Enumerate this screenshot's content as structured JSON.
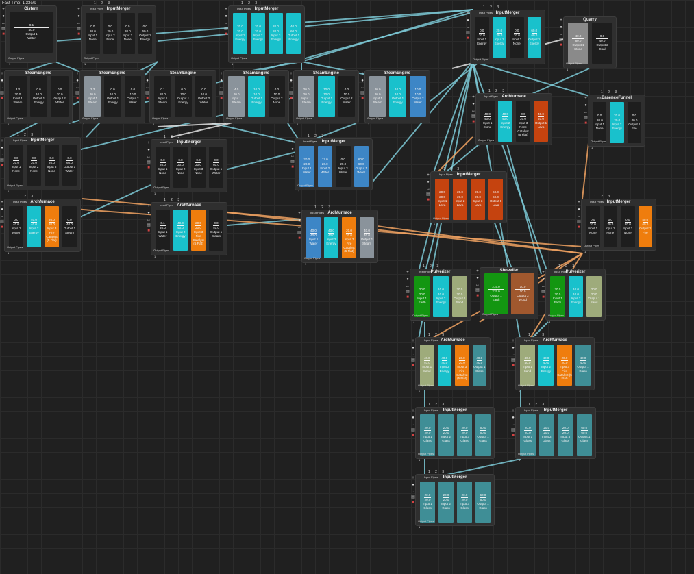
{
  "fps_label": "Fast Time: 1.33e/s",
  "labels": {
    "input_pipes": "Input Pipes",
    "output_pipes": "Output Pipes"
  },
  "colors": {
    "Water": "#19c1cc",
    "Energy": "#19c1cc",
    "Steam": "#8a939b",
    "Lava": "#c5430f",
    "Fire": "#ef7d0d",
    "Earth": "#139611",
    "Wood": "#a0582e",
    "Sand": "#9eab7b",
    "Glass": "#3f8e96",
    "None": "#1e1e1e",
    "Coal": "#1e1e1e",
    "WaterBlue": "#3d86c6",
    "Stone": "#8a8a8a"
  },
  "nodes": [
    {
      "id": "n1",
      "title": "Cistern",
      "ports": "",
      "cells": [
        {
          "v": "0.1",
          "v2": "40.0",
          "lb": "Output 1",
          "nm": "Water",
          "c": "#1e1e1e"
        }
      ]
    },
    {
      "id": "n2",
      "title": "InputMerger",
      "ports": "1 2 3",
      "cells": [
        {
          "v": "0.0",
          "v2": "20.0",
          "lb": "Input 1",
          "nm": "None",
          "c": "#1e1e1e"
        },
        {
          "v": "0.0",
          "v2": "20.0",
          "lb": "Input 2",
          "nm": "None",
          "c": "#1e1e1e"
        },
        {
          "v": "0.0",
          "v2": "20.0",
          "lb": "Input 3",
          "nm": "None",
          "c": "#1e1e1e"
        },
        {
          "v": "0.0",
          "v2": "60.0",
          "lb": "Output 1",
          "nm": "Energy",
          "c": "#1e1e1e"
        }
      ]
    },
    {
      "id": "n3",
      "title": "InputMerger",
      "ports": "1 2 3",
      "cells": [
        {
          "v": "20.0",
          "v2": "20.0",
          "lb": "Input 1",
          "nm": "Energy",
          "c": "#19c1cc"
        },
        {
          "v": "20.0",
          "v2": "20.0",
          "lb": "Input 2",
          "nm": "Energy",
          "c": "#19c1cc"
        },
        {
          "v": "20.0",
          "v2": "20.0",
          "lb": "Input 3",
          "nm": "Energy",
          "c": "#19c1cc"
        },
        {
          "v": "40.0",
          "v2": "60.0",
          "lb": "Output 1",
          "nm": "Energy",
          "c": "#19c1cc"
        }
      ]
    },
    {
      "id": "n4",
      "title": "InputMerger",
      "ports": "1 2 3",
      "cells": [
        {
          "v": "0.0",
          "v2": "20.0",
          "lb": "Input 1",
          "nm": "Energy",
          "c": "#1e1e1e"
        },
        {
          "v": "20.0",
          "v2": "20.0",
          "lb": "Input 2",
          "nm": "Energy",
          "c": "#19c1cc"
        },
        {
          "v": "0.0",
          "v2": "20.0",
          "lb": "Input 3",
          "nm": "None",
          "c": "#1e1e1e"
        },
        {
          "v": "60.0",
          "v2": "60.0",
          "lb": "Output 1",
          "nm": "Energy",
          "c": "#19c1cc"
        }
      ]
    },
    {
      "id": "n5",
      "title": "Quarry",
      "ports": "",
      "cells": [
        {
          "v": "40.0",
          "v2": "80.0",
          "lb": "Output 1",
          "nm": "Stone",
          "c": "#8a8a8a"
        },
        {
          "v": "0.0",
          "v2": "40.0",
          "lb": "Output 2",
          "nm": "Coal",
          "c": "#1e1e1e"
        }
      ]
    },
    {
      "id": "n6",
      "title": "SteamEngine",
      "ports": "",
      "cells": [
        {
          "v": "3.3",
          "v2": "20.0",
          "lb": "Input 1",
          "nm": "Steam",
          "c": "#1e1e1e"
        },
        {
          "v": "0.0",
          "v2": "10.0",
          "lb": "Output 1",
          "nm": "Energy",
          "c": "#1e1e1e"
        },
        {
          "v": "0.0",
          "v2": "10.0",
          "lb": "Output 2",
          "nm": "Water",
          "c": "#1e1e1e"
        }
      ]
    },
    {
      "id": "n7",
      "title": "SteamEngine",
      "ports": "",
      "cells": [
        {
          "v": "3.3",
          "v2": "20.0",
          "lb": "Input 1",
          "nm": "Steam",
          "c": "#8a939b"
        },
        {
          "v": "0.0",
          "v2": "10.0",
          "lb": "Output 1",
          "nm": "Energy",
          "c": "#1e1e1e"
        },
        {
          "v": "0.0",
          "v2": "10.0",
          "lb": "Output 2",
          "nm": "Water",
          "c": "#1e1e1e"
        }
      ]
    },
    {
      "id": "n8",
      "title": "SteamEngine",
      "ports": "",
      "cells": [
        {
          "v": "0.1",
          "v2": "20.0",
          "lb": "Input 1",
          "nm": "Steam",
          "c": "#1e1e1e"
        },
        {
          "v": "0.0",
          "v2": "10.0",
          "lb": "Output 1",
          "nm": "Energy",
          "c": "#1e1e1e"
        },
        {
          "v": "0.0",
          "v2": "10.0",
          "lb": "Output 2",
          "nm": "Water",
          "c": "#1e1e1e"
        }
      ]
    },
    {
      "id": "n9",
      "title": "SteamEngine",
      "ports": "",
      "cells": [
        {
          "v": "4.0",
          "v2": "20.0",
          "lb": "Input 1",
          "nm": "Steam",
          "c": "#8a939b"
        },
        {
          "v": "10.0",
          "v2": "10.0",
          "lb": "Output 1",
          "nm": "Energy",
          "c": "#19c1cc"
        },
        {
          "v": "0.0",
          "v2": "10.0",
          "lb": "Output 2",
          "nm": "None",
          "c": "#1e1e1e"
        }
      ]
    },
    {
      "id": "n10",
      "title": "SteamEngine",
      "ports": "",
      "cells": [
        {
          "v": "20.0",
          "v2": "20.0",
          "lb": "Input 1",
          "nm": "Steam",
          "c": "#8a939b"
        },
        {
          "v": "10.0",
          "v2": "10.0",
          "lb": "Output 1",
          "nm": "Energy",
          "c": "#19c1cc"
        },
        {
          "v": "0.0",
          "v2": "10.0",
          "lb": "Output 2",
          "nm": "Water",
          "c": "#1e1e1e"
        }
      ]
    },
    {
      "id": "n11",
      "title": "SteamEngine",
      "ports": "",
      "cells": [
        {
          "v": "20.0",
          "v2": "20.0",
          "lb": "Input 1",
          "nm": "Steam",
          "c": "#8a939b"
        },
        {
          "v": "10.0",
          "v2": "10.0",
          "lb": "Output 1",
          "nm": "Energy",
          "c": "#19c1cc"
        },
        {
          "v": "10.0",
          "v2": "10.0",
          "lb": "Output 2",
          "nm": "Water",
          "c": "#3d86c6"
        }
      ]
    },
    {
      "id": "n12",
      "title": "InputMerger",
      "ports": "1 2 3",
      "cells": [
        {
          "v": "0.0",
          "v2": "20.0",
          "lb": "Input 1",
          "nm": "None",
          "c": "#1e1e1e"
        },
        {
          "v": "0.0",
          "v2": "20.0",
          "lb": "Input 2",
          "nm": "None",
          "c": "#1e1e1e"
        },
        {
          "v": "0.0",
          "v2": "20.0",
          "lb": "Input 3",
          "nm": "None",
          "c": "#1e1e1e"
        },
        {
          "v": "0.0",
          "v2": "60.0",
          "lb": "Output 1",
          "nm": "Water",
          "c": "#1e1e1e"
        }
      ]
    },
    {
      "id": "n13",
      "title": "InputMerger",
      "ports": "1 2 3",
      "cells": [
        {
          "v": "0.0",
          "v2": "20.0",
          "lb": "Input 1",
          "nm": "None",
          "c": "#1e1e1e"
        },
        {
          "v": "0.0",
          "v2": "20.0",
          "lb": "Input 2",
          "nm": "None",
          "c": "#1e1e1e"
        },
        {
          "v": "0.0",
          "v2": "20.0",
          "lb": "Input 3",
          "nm": "None",
          "c": "#1e1e1e"
        },
        {
          "v": "0.0",
          "v2": "60.0",
          "lb": "Output 1",
          "nm": "Water",
          "c": "#1e1e1e"
        }
      ]
    },
    {
      "id": "n14",
      "title": "InputMerger",
      "ports": "1 2 3",
      "cells": [
        {
          "v": "20.0",
          "v2": "20.0",
          "lb": "Input 1",
          "nm": "Water",
          "c": "#3d86c6"
        },
        {
          "v": "17.0",
          "v2": "20.0",
          "lb": "Input 2",
          "nm": "Water",
          "c": "#3d86c6"
        },
        {
          "v": "0.0",
          "v2": "20.0",
          "lb": "Input 3",
          "nm": "Water",
          "c": "#1e1e1e"
        },
        {
          "v": "60.0",
          "v2": "60.0",
          "lb": "Output 1",
          "nm": "Water",
          "c": "#3d86c6"
        }
      ]
    },
    {
      "id": "n15",
      "title": "InputMerger",
      "ports": "1 2 3",
      "cells": [
        {
          "v": "20.0",
          "v2": "20.0",
          "lb": "Input 1",
          "nm": "Lava",
          "c": "#c5430f"
        },
        {
          "v": "20.0",
          "v2": "20.0",
          "lb": "Input 2",
          "nm": "Lava",
          "c": "#c5430f"
        },
        {
          "v": "20.0",
          "v2": "20.0",
          "lb": "Input 3",
          "nm": "Lava",
          "c": "#c5430f"
        },
        {
          "v": "60.0",
          "v2": "60.0",
          "lb": "Output 1",
          "nm": "Lava",
          "c": "#c5430f"
        }
      ]
    },
    {
      "id": "n16",
      "title": "Archfurnace",
      "ports": "1 2 3",
      "cells": [
        {
          "v": "0.0",
          "v2": "40.0",
          "lb": "Input 1",
          "nm": "Water",
          "c": "#1e1e1e"
        },
        {
          "v": "40.0",
          "v2": "40.0",
          "lb": "Input 2",
          "nm": "Energy",
          "c": "#19c1cc"
        },
        {
          "v": "20.0",
          "v2": "20.0",
          "lb": "Input 3",
          "nm": "Fire",
          "ex": "Catalyst (5 Flat)",
          "c": "#ef7d0d"
        },
        {
          "v": "0.0",
          "v2": "40.0",
          "lb": "Output 1",
          "nm": "Steam",
          "c": "#1e1e1e"
        }
      ]
    },
    {
      "id": "n17",
      "title": "Archfurnace",
      "ports": "1 2 3",
      "cells": [
        {
          "v": "0.1",
          "v2": "40.0",
          "lb": "Input 1",
          "nm": "Water",
          "c": "#1e1e1e"
        },
        {
          "v": "40.0",
          "v2": "40.0",
          "lb": "Input 2",
          "nm": "Energy",
          "c": "#19c1cc"
        },
        {
          "v": "20.0",
          "v2": "20.0",
          "lb": "Input 3",
          "nm": "Fire",
          "ex": "Catalyst (5 Flat)",
          "c": "#ef7d0d"
        },
        {
          "v": "0.0",
          "v2": "40.0",
          "lb": "Output 1",
          "nm": "Steam",
          "c": "#1e1e1e"
        }
      ]
    },
    {
      "id": "n18",
      "title": "Archfurnace",
      "ports": "1 2 3",
      "cells": [
        {
          "v": "40.0",
          "v2": "40.0",
          "lb": "Input 1",
          "nm": "Water",
          "c": "#3d86c6"
        },
        {
          "v": "40.0",
          "v2": "40.0",
          "lb": "Input 2",
          "nm": "Energy",
          "c": "#19c1cc"
        },
        {
          "v": "20.0",
          "v2": "20.0",
          "lb": "Input 3",
          "nm": "Fire",
          "ex": "Catalyst (5 Flat)",
          "c": "#ef7d0d"
        },
        {
          "v": "40.0",
          "v2": "40.0",
          "lb": "Output 1",
          "nm": "Steam",
          "c": "#8a939b"
        }
      ]
    },
    {
      "id": "n19",
      "title": "Archfurnace",
      "ports": "1 2 3",
      "cells": [
        {
          "v": "40.0",
          "v2": "40.0",
          "lb": "Input 1",
          "nm": "Stone",
          "c": "#1e1e1e"
        },
        {
          "v": "40.0",
          "v2": "40.0",
          "lb": "Input 2",
          "nm": "Energy",
          "c": "#19c1cc"
        },
        {
          "v": "0.0",
          "v2": "20.0",
          "lb": "Input 3",
          "nm": "None",
          "ex": "Catalyst (5 Flat)",
          "c": "#1e1e1e"
        },
        {
          "v": "40.0",
          "v2": "40.0",
          "lb": "Output 1",
          "nm": "Lava",
          "c": "#c5430f"
        }
      ]
    },
    {
      "id": "n20",
      "title": "EssenceFunnel",
      "ports": "1 2 3",
      "cells": [
        {
          "v": "0.0",
          "v2": "20.0",
          "lb": "Input 1",
          "nm": "None",
          "c": "#1e1e1e"
        },
        {
          "v": "20.0",
          "v2": "20.0",
          "lb": "Input 2",
          "nm": "Energy",
          "c": "#19c1cc"
        },
        {
          "v": "0.0",
          "v2": "40.0",
          "lb": "Output 1",
          "nm": "Fire",
          "c": "#1e1e1e"
        }
      ]
    },
    {
      "id": "n21",
      "title": "InputMerger",
      "ports": "1 2 3",
      "cells": [
        {
          "v": "0.0",
          "v2": "20.0",
          "lb": "Input 1",
          "nm": "None",
          "c": "#1e1e1e"
        },
        {
          "v": "0.0",
          "v2": "20.0",
          "lb": "Input 2",
          "nm": "None",
          "c": "#1e1e1e"
        },
        {
          "v": "0.0",
          "v2": "20.0",
          "lb": "Input 3",
          "nm": "None",
          "c": "#1e1e1e"
        },
        {
          "v": "40.0",
          "v2": "60.0",
          "lb": "Output 1",
          "nm": "Fire",
          "c": "#ef7d0d"
        }
      ]
    },
    {
      "id": "n22",
      "title": "Pulverizer",
      "ports": "1 2 3",
      "cells": [
        {
          "v": "20.0",
          "v2": "20.0",
          "lb": "Input 1",
          "nm": "Earth",
          "c": "#139611"
        },
        {
          "v": "10.0",
          "v2": "10.0",
          "lb": "Input 2",
          "nm": "Energy",
          "c": "#19c1cc"
        },
        {
          "v": "20.0",
          "v2": "20.0",
          "lb": "Output 1",
          "nm": "Sand",
          "c": "#9eab7b"
        }
      ]
    },
    {
      "id": "n23",
      "title": "Shoveller",
      "ports": "",
      "cells": [
        {
          "v": "215.0",
          "v2": "215.0",
          "lb": "Output 1",
          "nm": "Earth",
          "c": "#139611"
        },
        {
          "v": "10.0",
          "v2": "10.0",
          "lb": "Output 2",
          "nm": "Wood",
          "c": "#a0582e"
        }
      ]
    },
    {
      "id": "n24",
      "title": "Pulverizer",
      "ports": "1 2 3",
      "cells": [
        {
          "v": "20.0",
          "v2": "20.0",
          "lb": "Input 1",
          "nm": "Earth",
          "c": "#139611"
        },
        {
          "v": "10.0",
          "v2": "10.0",
          "lb": "Input 2",
          "nm": "Energy",
          "c": "#19c1cc"
        },
        {
          "v": "20.0",
          "v2": "20.0",
          "lb": "Output 1",
          "nm": "Sand",
          "c": "#9eab7b"
        }
      ]
    },
    {
      "id": "n25",
      "title": "Archfurnace",
      "ports": "1 2 3",
      "cells": [
        {
          "v": "40.0",
          "v2": "40.0",
          "lb": "Input 1",
          "nm": "Sand",
          "c": "#9eab7b"
        },
        {
          "v": "40.0",
          "v2": "40.0",
          "lb": "Input 2",
          "nm": "Energy",
          "c": "#19c1cc"
        },
        {
          "v": "20.0",
          "v2": "20.0",
          "lb": "Input 3",
          "nm": "Fire",
          "ex": "Catalyst (5 Flat)",
          "c": "#ef7d0d"
        },
        {
          "v": "40.0",
          "v2": "40.0",
          "lb": "Output 1",
          "nm": "Glass",
          "c": "#3f8e96"
        }
      ]
    },
    {
      "id": "n26",
      "title": "Archfurnace",
      "ports": "1 2 3",
      "cells": [
        {
          "v": "40.0",
          "v2": "40.0",
          "lb": "Input 1",
          "nm": "Sand",
          "c": "#9eab7b"
        },
        {
          "v": "40.0",
          "v2": "40.0",
          "lb": "Input 2",
          "nm": "Energy",
          "c": "#19c1cc"
        },
        {
          "v": "20.0",
          "v2": "20.0",
          "lb": "Input 3",
          "nm": "Fire",
          "ex": "Catalyst (5 Flat)",
          "c": "#ef7d0d"
        },
        {
          "v": "40.0",
          "v2": "40.0",
          "lb": "Output 1",
          "nm": "Glass",
          "c": "#3f8e96"
        }
      ]
    },
    {
      "id": "n27",
      "title": "InputMerger",
      "ports": "1 2 3",
      "cells": [
        {
          "v": "20.0",
          "v2": "20.0",
          "lb": "Input 1",
          "nm": "Glass",
          "c": "#3f8e96"
        },
        {
          "v": "20.0",
          "v2": "20.0",
          "lb": "Input 2",
          "nm": "Glass",
          "c": "#3f8e96"
        },
        {
          "v": "20.0",
          "v2": "20.0",
          "lb": "Input 3",
          "nm": "Glass",
          "c": "#3f8e96"
        },
        {
          "v": "60.0",
          "v2": "60.0",
          "lb": "Output 1",
          "nm": "Glass",
          "c": "#3f8e96"
        }
      ]
    },
    {
      "id": "n28",
      "title": "InputMerger",
      "ports": "1 2 3",
      "cells": [
        {
          "v": "20.0",
          "v2": "20.0",
          "lb": "Input 1",
          "nm": "Glass",
          "c": "#3f8e96"
        },
        {
          "v": "20.0",
          "v2": "20.0",
          "lb": "Input 2",
          "nm": "Glass",
          "c": "#3f8e96"
        },
        {
          "v": "20.0",
          "v2": "20.0",
          "lb": "Input 3",
          "nm": "Glass",
          "c": "#3f8e96"
        },
        {
          "v": "60.0",
          "v2": "60.0",
          "lb": "Output 1",
          "nm": "Glass",
          "c": "#3f8e96"
        }
      ]
    },
    {
      "id": "n29",
      "title": "InputMerger",
      "ports": "1 2 3",
      "cells": [
        {
          "v": "20.0",
          "v2": "20.0",
          "lb": "Input 1",
          "nm": "Glass",
          "c": "#3f8e96"
        },
        {
          "v": "20.0",
          "v2": "20.0",
          "lb": "Input 2",
          "nm": "Glass",
          "c": "#3f8e96"
        },
        {
          "v": "20.0",
          "v2": "20.0",
          "lb": "Input 3",
          "nm": "Glass",
          "c": "#3f8e96"
        },
        {
          "v": "60.0",
          "v2": "60.0",
          "lb": "Output 1",
          "nm": "Glass",
          "c": "#3f8e96"
        }
      ]
    }
  ]
}
